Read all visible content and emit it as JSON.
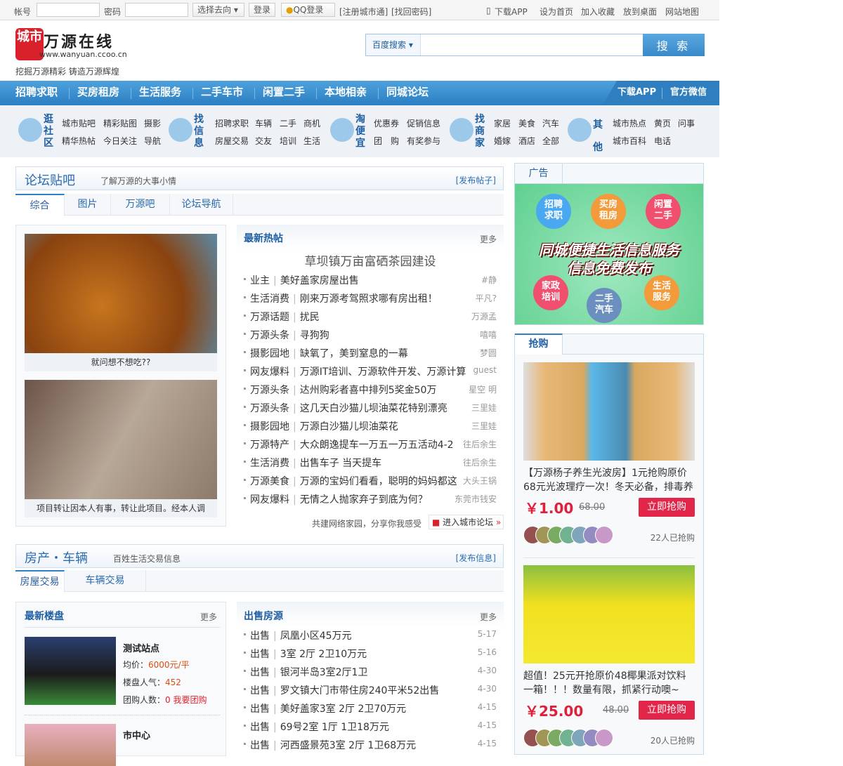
{
  "topbar": {
    "account_label": "帐号",
    "password_label": "密码",
    "destination": "选择去向",
    "login": "登录",
    "qq_login": "QQ登录",
    "register": "[注册城市通]",
    "recover": "[找回密码]",
    "links": [
      "下载APP",
      "设为首页",
      "加入收藏",
      "放到桌面",
      "网站地图"
    ]
  },
  "header": {
    "logo_badge": "城市",
    "site_name": "万源在线",
    "site_url": "www.wanyuan.ccoo.cn",
    "slogan": "挖掘万源精彩 铸造万源辉煌",
    "search_engine": "百度搜索",
    "search_placeholder": "",
    "search_button": "搜 索"
  },
  "nav": {
    "items": [
      "招聘求职",
      "买房租房",
      "生活服务",
      "二手车市",
      "闲置二手",
      "本地相亲",
      "同城论坛"
    ],
    "right": [
      "下载APP",
      "官方微信"
    ]
  },
  "quick": [
    {
      "title": "逛社区",
      "links": [
        "城市贴吧",
        "精彩贴图",
        "摄影",
        "精华热帖",
        "今日关注",
        "导航"
      ]
    },
    {
      "title": "找信息",
      "links": [
        "招聘求职",
        "车辆",
        "二手",
        "商机",
        "房屋交易",
        "交友",
        "培训",
        "生活"
      ]
    },
    {
      "title": "淘便宜",
      "links": [
        "优惠券",
        "促销信息",
        "团　购",
        "有奖参与"
      ]
    },
    {
      "title": "找商家",
      "links": [
        "家居",
        "美食",
        "汽车",
        "婚嫁",
        "酒店",
        "全部"
      ]
    },
    {
      "title": "其他",
      "links": [
        "城市热点",
        "黄页",
        "问事",
        "城市百科",
        "电话"
      ]
    }
  ],
  "forum": {
    "title": "论坛贴吧",
    "subtitle": "了解万源的大事小情",
    "action": "[发布帖子]",
    "tabs": [
      "综合",
      "图片",
      "万源吧",
      "论坛导航"
    ],
    "pics": [
      {
        "caption": "就问想不想吃??"
      },
      {
        "caption": "项目转让因本人有事，转让此项目。经本人调"
      }
    ],
    "hot_title": "最新热帖",
    "more": "更多",
    "headline": "草坝镇万亩富硒茶园建设",
    "posts": [
      {
        "cat": "业主",
        "title": "美好盖家房屋出售",
        "author": "#静"
      },
      {
        "cat": "生活消费",
        "title": "刚来万源考驾照求哪有房出租！",
        "author": "平凡?"
      },
      {
        "cat": "万源话题",
        "title": "扰民",
        "author": "万源孟"
      },
      {
        "cat": "万源头条",
        "title": "寻狗狗",
        "author": "嘻嘻"
      },
      {
        "cat": "摄影园地",
        "title": "缺氧了，美到窒息的一幕",
        "author": "梦圆"
      },
      {
        "cat": "网友爆料",
        "title": "万源IT培训、万源软件开发、万源计算",
        "author": "guest"
      },
      {
        "cat": "万源头条",
        "title": "达州购彩者喜中排列5奖金50万",
        "author": "星空 明"
      },
      {
        "cat": "万源头条",
        "title": "这几天白沙猫儿坝油菜花特别漂亮",
        "author": "三里娃"
      },
      {
        "cat": "摄影园地",
        "title": "万源白沙猫儿坝油菜花",
        "author": "三里娃"
      },
      {
        "cat": "万源特产",
        "title": "大众朗逸提车一万五一万五活动4-2",
        "author": "往后余生"
      },
      {
        "cat": "生活消费",
        "title": "出售车子 当天提车",
        "author": "往后余生"
      },
      {
        "cat": "万源美食",
        "title": "万源的宝妈们看看，聪明的妈妈都这",
        "author": "大头王锅"
      },
      {
        "cat": "网友爆料",
        "title": "无情之人抛家弃子到底为何？",
        "author": "东莞市钱安"
      }
    ],
    "footer_text": "共建网络家园，分享你我感受",
    "enter_forum": "进入城市论坛"
  },
  "house": {
    "title": "房产・车辆",
    "subtitle": "百姓生活交易信息",
    "action": "[发布信息]",
    "tabs": [
      "房屋交易",
      "车辆交易"
    ],
    "new_title": "最新楼盘",
    "more": "更多",
    "estates": [
      {
        "name": "测试站点",
        "price_label": "均价：",
        "price": "6000元/平",
        "pop_label": "楼盘人气：",
        "pop": "452",
        "group_label": "团购人数：",
        "group": "0",
        "group_link": "我要团购"
      },
      {
        "name": "市中心"
      }
    ],
    "sale_title": "出售房源",
    "sales": [
      {
        "cat": "出售",
        "title": "凤凰小区45万元",
        "date": "5-17"
      },
      {
        "cat": "出售",
        "title": "3室 2厅 2卫10万元",
        "date": "5-16"
      },
      {
        "cat": "出售",
        "title": "银河半岛3室2厅1卫",
        "date": "4-30"
      },
      {
        "cat": "出售",
        "title": "罗文镇大门市带住房240平米52出售",
        "date": "4-30"
      },
      {
        "cat": "出售",
        "title": "美好盖家3室 2厅 2卫70万元",
        "date": "4-15"
      },
      {
        "cat": "出售",
        "title": "69号2室 1厅 1卫18万元",
        "date": "4-15"
      },
      {
        "cat": "出售",
        "title": "河西盛景苑3室 2厅 1卫68万元",
        "date": "4-15"
      }
    ]
  },
  "ad": {
    "tab": "广告",
    "bubbles": [
      "招聘求职",
      "买房租房",
      "闲置二手",
      "家政培训",
      "二手汽车",
      "生活服务"
    ],
    "line1": "同城便捷生活信息服务",
    "line2": "信息免费发布"
  },
  "deals": {
    "tab": "抢购",
    "items": [
      {
        "title": "【万源杨子养生光波房】1元抢购原价68元光波理疗一次！冬天必备，排毒养",
        "price": "￥1.00",
        "orig": "68.00",
        "button": "立即抢购",
        "count": "22人已抢购"
      },
      {
        "title": "超值！25元开抢原价48椰果派对饮料一箱！！！数量有限，抓紧行动噢~",
        "price": "￥25.00",
        "orig": "48.00",
        "button": "立即抢购",
        "count": "20人已抢购"
      }
    ]
  }
}
